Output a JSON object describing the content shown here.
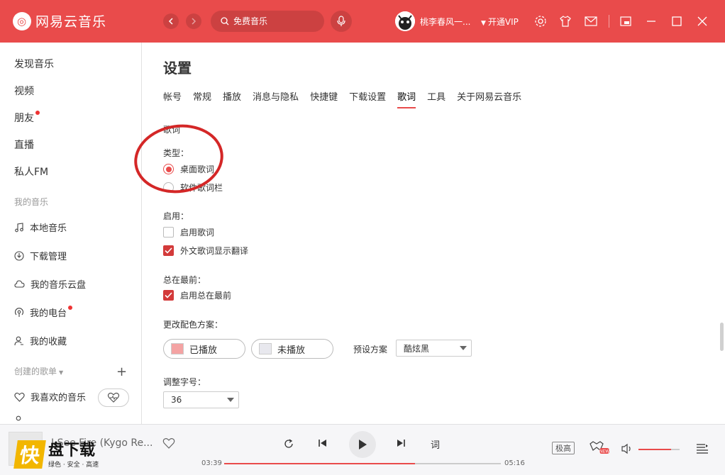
{
  "app": {
    "name": "网易云音乐",
    "logo_glyph": "◎"
  },
  "search": {
    "placeholder": "免费音乐"
  },
  "user": {
    "name": "桃李春风一...",
    "vip_label": "开通VIP"
  },
  "sidebar": {
    "items": [
      {
        "label": "发现音乐"
      },
      {
        "label": "视频"
      },
      {
        "label": "朋友",
        "badge": true
      },
      {
        "label": "直播"
      },
      {
        "label": "私人FM"
      }
    ],
    "my_music_header": "我的音乐",
    "my_music": [
      {
        "label": "本地音乐",
        "icon": "music-note-icon"
      },
      {
        "label": "下载管理",
        "icon": "download-icon"
      },
      {
        "label": "我的音乐云盘",
        "icon": "cloud-icon"
      },
      {
        "label": "我的电台",
        "icon": "radio-icon",
        "badge": true
      },
      {
        "label": "我的收藏",
        "icon": "user-icon"
      }
    ],
    "playlists_header": "创建的歌单",
    "liked_label": "我喜欢的音乐"
  },
  "settings": {
    "title": "设置",
    "tabs": [
      "帐号",
      "常规",
      "播放",
      "消息与隐私",
      "快捷键",
      "下载设置",
      "歌词",
      "工具",
      "关于网易云音乐"
    ],
    "active_tab": "歌词",
    "section_title": "歌词",
    "type_label": "类型：",
    "type_options": [
      {
        "label": "桌面歌词",
        "selected": true
      },
      {
        "label": "软件歌词栏",
        "selected": false
      }
    ],
    "enable_label": "启用：",
    "enable_options": [
      {
        "label": "启用歌词",
        "checked": false
      },
      {
        "label": "外文歌词显示翻译",
        "checked": true
      }
    ],
    "top_label": "总在最前：",
    "top_option": {
      "label": "启用总在最前",
      "checked": true
    },
    "color_label": "更改配色方案：",
    "played_label": "已播放",
    "unplayed_label": "未播放",
    "preset_label": "预设方案",
    "preset_value": "酷炫黑",
    "fontsize_label": "调整字号：",
    "fontsize_value": "36",
    "colors": {
      "played": "#f4a3a3",
      "unplayed": "#e8e8ee",
      "accent": "#e94b4b"
    }
  },
  "player": {
    "song_title": "I See Fire (Kygo Re...",
    "current_time": "03:39",
    "total_time": "05:16",
    "progress": 0.69,
    "quality": "极高",
    "lyric_label": "词",
    "volume": 0.8
  },
  "watermark": {
    "glyph": "快",
    "title": "盘下载",
    "subtitle": "绿色 · 安全 · 高速"
  }
}
